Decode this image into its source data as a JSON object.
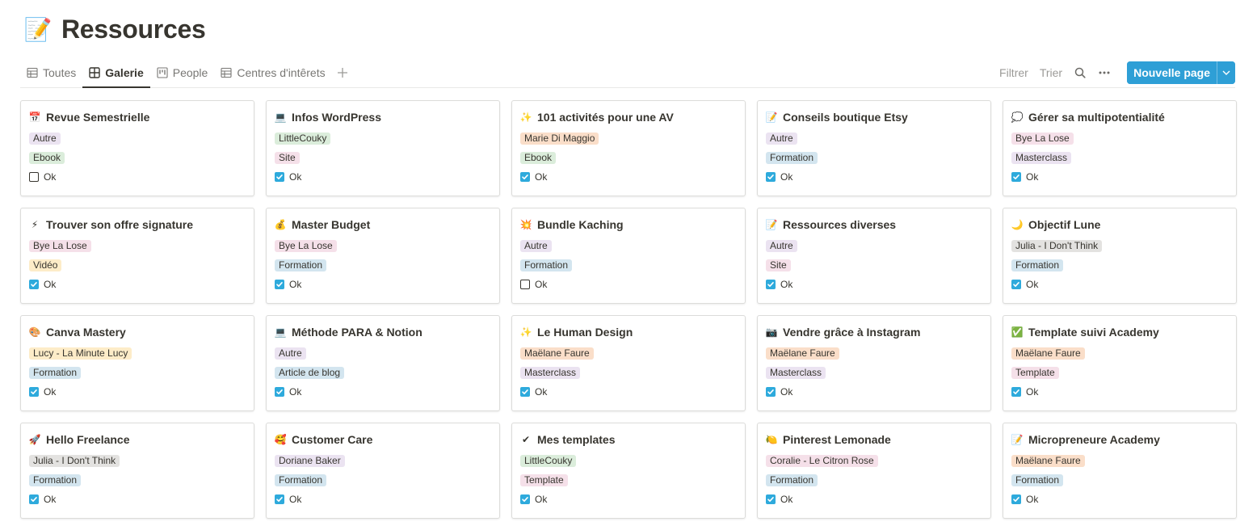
{
  "page": {
    "emoji": "📝",
    "title": "Ressources"
  },
  "views": {
    "tabs": [
      {
        "label": "Toutes",
        "icon": "table-icon",
        "active": false
      },
      {
        "label": "Galerie",
        "icon": "gallery-icon",
        "active": true
      },
      {
        "label": "People",
        "icon": "board-icon",
        "active": false
      },
      {
        "label": "Centres d'intêrets",
        "icon": "table-icon",
        "active": false
      }
    ],
    "add_icon": "plus-icon"
  },
  "toolbar": {
    "filter_label": "Filtrer",
    "sort_label": "Trier",
    "search_icon": "search-icon",
    "more_icon": "more-icon",
    "new_label": "Nouvelle page",
    "new_caret_icon": "chevron-down-icon",
    "accent_color": "#2e9fd6"
  },
  "tag_colors": {
    "purple": "#ebe3f1",
    "green": "#dbeddb",
    "pink": "#f5e0e9",
    "orange": "#fadec9",
    "blue": "#d3e5ef",
    "yellow": "#fdecc8",
    "gray": "#e3e2e0"
  },
  "cards": [
    {
      "title": "Revue Semestrielle",
      "emoji": "📅",
      "tags": [
        {
          "label": "Autre",
          "color": "purple"
        },
        {
          "label": "Ebook",
          "color": "green"
        }
      ],
      "checked": false,
      "check_label": "Ok"
    },
    {
      "title": "Infos WordPress",
      "emoji": "💻",
      "tags": [
        {
          "label": "LittleCouky",
          "color": "green"
        },
        {
          "label": "Site",
          "color": "pink"
        }
      ],
      "checked": true,
      "check_label": "Ok"
    },
    {
      "title": "101 activités pour une AV",
      "emoji": "✨",
      "tags": [
        {
          "label": "Marie Di Maggio",
          "color": "orange"
        },
        {
          "label": "Ebook",
          "color": "green"
        }
      ],
      "checked": true,
      "check_label": "Ok"
    },
    {
      "title": "Conseils boutique Etsy",
      "emoji": "📝",
      "tags": [
        {
          "label": "Autre",
          "color": "purple"
        },
        {
          "label": "Formation",
          "color": "blue"
        }
      ],
      "checked": true,
      "check_label": "Ok"
    },
    {
      "title": "Gérer sa multipotentialité",
      "emoji": "💭",
      "tags": [
        {
          "label": "Bye La Lose",
          "color": "pink"
        },
        {
          "label": "Masterclass",
          "color": "purple"
        }
      ],
      "checked": true,
      "check_label": "Ok"
    },
    {
      "title": "Trouver son offre signature",
      "emoji": "⚡",
      "tags": [
        {
          "label": "Bye La Lose",
          "color": "pink"
        },
        {
          "label": "Vidéo",
          "color": "yellow"
        }
      ],
      "checked": true,
      "check_label": "Ok"
    },
    {
      "title": "Master Budget",
      "emoji": "💰",
      "tags": [
        {
          "label": "Bye La Lose",
          "color": "pink"
        },
        {
          "label": "Formation",
          "color": "blue"
        }
      ],
      "checked": true,
      "check_label": "Ok"
    },
    {
      "title": "Bundle Kaching",
      "emoji": "💥",
      "tags": [
        {
          "label": "Autre",
          "color": "purple"
        },
        {
          "label": "Formation",
          "color": "blue"
        }
      ],
      "checked": false,
      "check_label": "Ok"
    },
    {
      "title": "Ressources diverses",
      "emoji": "📝",
      "tags": [
        {
          "label": "Autre",
          "color": "purple"
        },
        {
          "label": "Site",
          "color": "pink"
        }
      ],
      "checked": true,
      "check_label": "Ok"
    },
    {
      "title": "Objectif Lune",
      "emoji": "🌙",
      "tags": [
        {
          "label": "Julia - I Don't Think",
          "color": "gray"
        },
        {
          "label": "Formation",
          "color": "blue"
        }
      ],
      "checked": true,
      "check_label": "Ok"
    },
    {
      "title": "Canva Mastery",
      "emoji": "🎨",
      "tags": [
        {
          "label": "Lucy - La Minute Lucy",
          "color": "yellow"
        },
        {
          "label": "Formation",
          "color": "blue"
        }
      ],
      "checked": true,
      "check_label": "Ok"
    },
    {
      "title": "Méthode PARA & Notion",
      "emoji": "💻",
      "tags": [
        {
          "label": "Autre",
          "color": "purple"
        },
        {
          "label": "Article de blog",
          "color": "blue"
        }
      ],
      "checked": true,
      "check_label": "Ok"
    },
    {
      "title": "Le Human Design",
      "emoji": "✨",
      "tags": [
        {
          "label": "Maëlane Faure",
          "color": "orange"
        },
        {
          "label": "Masterclass",
          "color": "purple"
        }
      ],
      "checked": true,
      "check_label": "Ok"
    },
    {
      "title": "Vendre grâce à Instagram",
      "emoji": "📷",
      "tags": [
        {
          "label": "Maëlane Faure",
          "color": "orange"
        },
        {
          "label": "Masterclass",
          "color": "purple"
        }
      ],
      "checked": true,
      "check_label": "Ok"
    },
    {
      "title": "Template suivi Academy",
      "emoji": "✅",
      "tags": [
        {
          "label": "Maëlane Faure",
          "color": "orange"
        },
        {
          "label": "Template",
          "color": "pink"
        }
      ],
      "checked": true,
      "check_label": "Ok"
    },
    {
      "title": "Hello Freelance",
      "emoji": "🚀",
      "tags": [
        {
          "label": "Julia - I Don't Think",
          "color": "gray"
        },
        {
          "label": "Formation",
          "color": "blue"
        }
      ],
      "checked": true,
      "check_label": "Ok"
    },
    {
      "title": "Customer Care",
      "emoji": "🥰",
      "tags": [
        {
          "label": "Doriane Baker",
          "color": "purple"
        },
        {
          "label": "Formation",
          "color": "blue"
        }
      ],
      "checked": true,
      "check_label": "Ok"
    },
    {
      "title": "Mes templates",
      "emoji": "✔",
      "tags": [
        {
          "label": "LittleCouky",
          "color": "green"
        },
        {
          "label": "Template",
          "color": "pink"
        }
      ],
      "checked": true,
      "check_label": "Ok"
    },
    {
      "title": "Pinterest Lemonade",
      "emoji": "🍋",
      "tags": [
        {
          "label": "Coralie - Le Citron Rose",
          "color": "pink"
        },
        {
          "label": "Formation",
          "color": "blue"
        }
      ],
      "checked": true,
      "check_label": "Ok"
    },
    {
      "title": "Micropreneure Academy",
      "emoji": "📝",
      "tags": [
        {
          "label": "Maëlane Faure",
          "color": "orange"
        },
        {
          "label": "Formation",
          "color": "blue"
        }
      ],
      "checked": true,
      "check_label": "Ok"
    }
  ]
}
